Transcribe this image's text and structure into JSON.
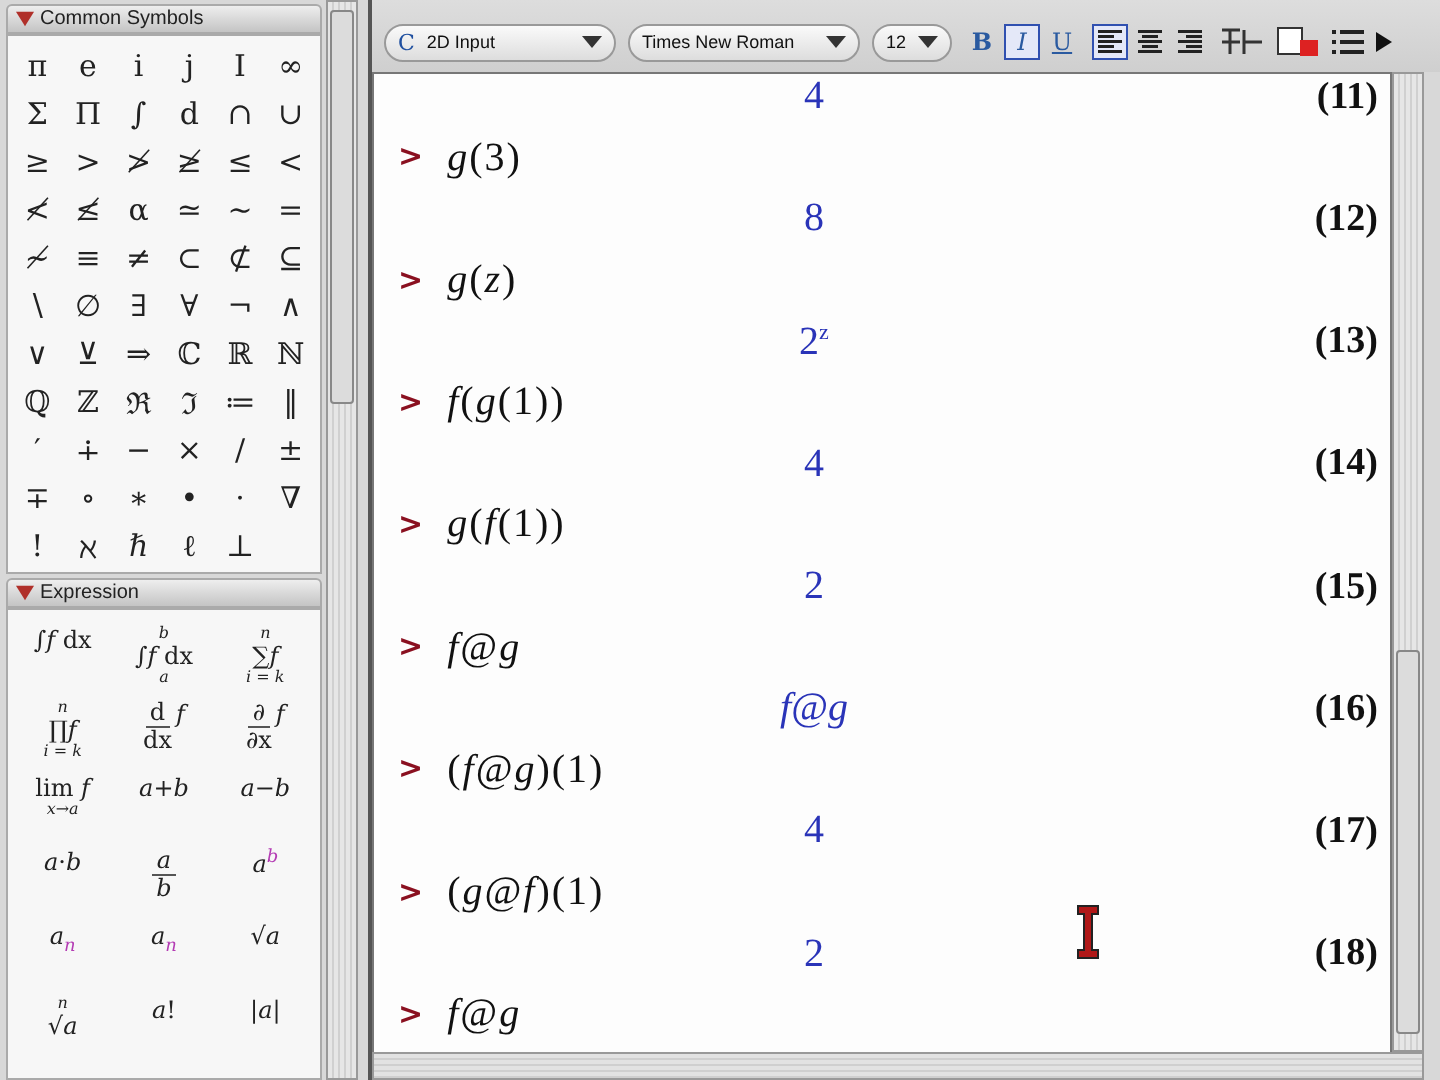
{
  "toolbar": {
    "mode_glyph": "C",
    "mode": "2D Input",
    "font": "Times New Roman",
    "size": "12",
    "styles": [
      {
        "kind": "bold",
        "label": "B",
        "selected": false
      },
      {
        "kind": "italic",
        "label": "I",
        "selected": true
      },
      {
        "kind": "underline",
        "label": "U",
        "selected": false
      }
    ],
    "align": [
      {
        "kind": "left",
        "selected": true
      },
      {
        "kind": "center",
        "selected": false
      },
      {
        "kind": "right",
        "selected": false
      }
    ]
  },
  "palettes": [
    {
      "title": "Common Symbols",
      "expanded": true,
      "symbols": [
        "π",
        "e",
        "i",
        "j",
        "I",
        "∞",
        "Σ",
        "Π",
        "∫",
        "d",
        "∩",
        "∪",
        "≥",
        ">",
        "≯",
        "≱",
        "≤",
        "<",
        "≮",
        "≰",
        "α",
        "≃",
        "~",
        "=",
        "≁",
        "≡",
        "≠",
        "⊂",
        "⊄",
        "⊆",
        "∖",
        "∅",
        "∃",
        "∀",
        "¬",
        "∧",
        "∨",
        "⊻",
        "⇒",
        "ℂ",
        "ℝ",
        "ℕ",
        "ℚ",
        "ℤ",
        "ℜ",
        "ℑ",
        "≔",
        "‖",
        "′",
        "∔",
        "−",
        "×",
        "/",
        "±",
        "∓",
        "∘",
        "∗",
        "•",
        "·",
        "∇",
        "!",
        "ℵ",
        "ℏ",
        "ℓ",
        "⊥"
      ]
    },
    {
      "title": "Expression",
      "expanded": true,
      "items": [
        {
          "kind": "plain",
          "main": "∫*f* dx"
        },
        {
          "kind": "plain",
          "main": "∫*f* dx",
          "upper": "*b*",
          "lower": "*a*"
        },
        {
          "kind": "plain",
          "main": "∑*f*",
          "upper": "*n*",
          "lower": "*i* = *k*"
        },
        {
          "kind": "plain",
          "main": "∏*f*",
          "upper": "*n*",
          "lower": "*i* = *k*"
        },
        {
          "kind": "fraction",
          "num": "d",
          "den": "dx",
          "after": "*f*"
        },
        {
          "kind": "fraction",
          "num": "∂",
          "den": "∂x",
          "after": "*f*"
        },
        {
          "kind": "plain",
          "main": "lim *f*",
          "lower": "*x*→*a*"
        },
        {
          "kind": "plain",
          "main": "*a*+*b*"
        },
        {
          "kind": "plain",
          "main": "*a*−*b*"
        },
        {
          "kind": "plain",
          "main": "*a*·*b*"
        },
        {
          "kind": "fraction",
          "num": "*a*",
          "den": "*b*"
        },
        {
          "kind": "plain",
          "main": "*a*$^{b}$"
        },
        {
          "kind": "plain",
          "main": "*a*$_{n}$"
        },
        {
          "kind": "plain",
          "main": "*a*$_{n}$"
        },
        {
          "kind": "plain",
          "main": "√*a*"
        },
        {
          "kind": "plain",
          "main": "√*a*",
          "upper": "*n*"
        },
        {
          "kind": "plain",
          "main": "*a*!"
        },
        {
          "kind": "plain",
          "main": "|*a*|"
        }
      ]
    }
  ],
  "worksheet": {
    "lines": [
      {
        "kind": "output",
        "value": "4",
        "label": "(11)"
      },
      {
        "kind": "input",
        "prompt": ">",
        "text": "*g*(3)"
      },
      {
        "kind": "output",
        "value": "8",
        "label": "(12)"
      },
      {
        "kind": "input",
        "prompt": ">",
        "text": "*g*(*z*)"
      },
      {
        "kind": "output",
        "value": "2$^{z}$",
        "label": "(13)"
      },
      {
        "kind": "input",
        "prompt": ">",
        "text": "*f*(*g*(1))"
      },
      {
        "kind": "output",
        "value": "4",
        "label": "(14)"
      },
      {
        "kind": "input",
        "prompt": ">",
        "text": "*g*(*f*(1))"
      },
      {
        "kind": "output",
        "value": "2",
        "label": "(15)"
      },
      {
        "kind": "input",
        "prompt": ">",
        "text": "*f*@*g*"
      },
      {
        "kind": "output",
        "value": "*f*@*g*",
        "label": "(16)"
      },
      {
        "kind": "input",
        "prompt": ">",
        "text": "(*f*@*g*)(1)"
      },
      {
        "kind": "output",
        "value": "4",
        "label": "(17)"
      },
      {
        "kind": "input",
        "prompt": ">",
        "text": "(*g*@*f*)(1)"
      },
      {
        "kind": "output",
        "value": "2",
        "label": "(18)"
      },
      {
        "kind": "input",
        "prompt": ">",
        "text": "*f*@*g*"
      }
    ]
  }
}
